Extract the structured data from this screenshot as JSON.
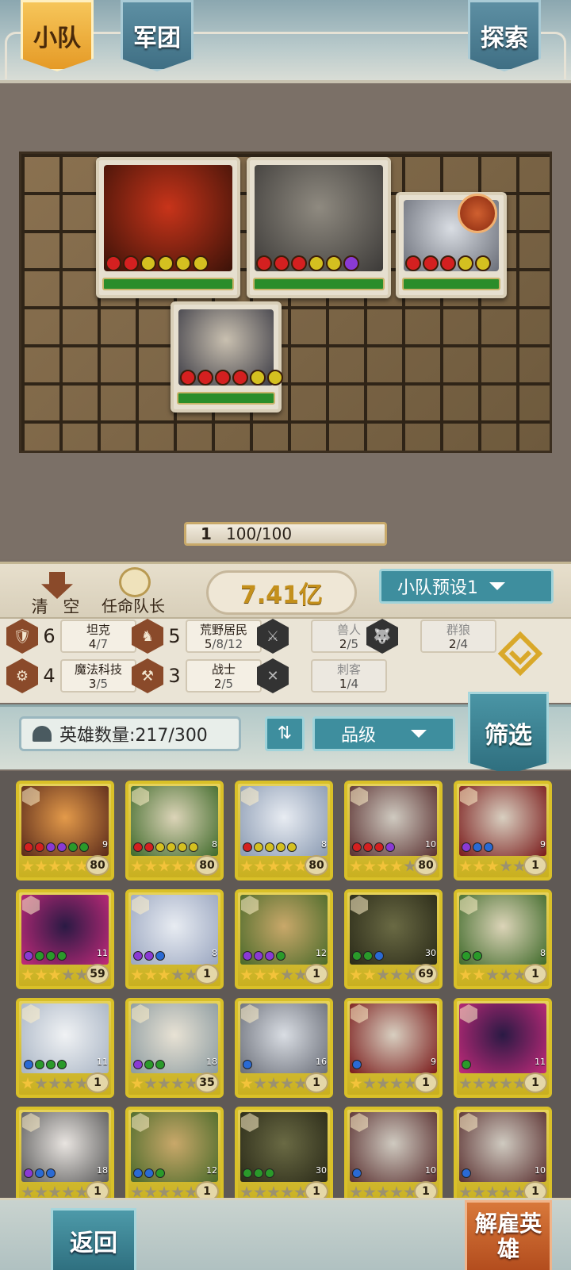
{
  "tabs": {
    "squad": "小队",
    "legion": "军团",
    "explore": "探索"
  },
  "board": {
    "level": "1",
    "progress": "100/100",
    "cards": [
      {
        "name": "fire-beast",
        "dots": [
          "#d42020",
          "#d42020",
          "#d4c020",
          "#d4c020",
          "#d4c020",
          "#d4c020"
        ],
        "colors": [
          "#c8341a",
          "#3a1208"
        ]
      },
      {
        "name": "stone-golem",
        "dots": [
          "#d42020",
          "#d42020",
          "#d42020",
          "#d4c020",
          "#d4c020",
          "#8a3ad4"
        ],
        "colors": [
          "#8f8a80",
          "#3c3a38"
        ]
      },
      {
        "name": "white-wolf",
        "dots": [
          "#d42020",
          "#d42020",
          "#d42020",
          "#d4c020",
          "#d4c020"
        ],
        "colors": [
          "#d9dde3",
          "#6a6e78"
        ]
      },
      {
        "name": "dark-wolf",
        "dots": [
          "#d42020",
          "#d42020",
          "#d42020",
          "#d42020",
          "#d4c020",
          "#d4c020"
        ],
        "colors": [
          "#c9c0b0",
          "#3a3a44"
        ]
      }
    ]
  },
  "captain": {
    "clear": "清 空",
    "appoint": "任命队长",
    "power": "7.41亿",
    "preset": "小队预设1"
  },
  "synergies": [
    {
      "count": "6",
      "name": "坦克",
      "cur": "4",
      "total": "/7",
      "icon": "🛡",
      "active": true
    },
    {
      "count": "5",
      "name": "荒野居民",
      "cur": "5",
      "total": "/8/12",
      "icon": "♞",
      "active": true
    },
    {
      "count": "",
      "name": "兽人",
      "cur": "2",
      "total": "/5",
      "icon": "⚔",
      "active": false
    },
    {
      "count": "",
      "name": "群狼",
      "cur": "2",
      "total": "/4",
      "icon": "🐺",
      "active": false
    },
    {
      "count": "4",
      "name": "魔法科技",
      "cur": "3",
      "total": "/5",
      "icon": "⚙",
      "active": true
    },
    {
      "count": "3",
      "name": "战士",
      "cur": "2",
      "total": "/5",
      "icon": "⚒",
      "active": true
    },
    {
      "count": "",
      "name": "刺客",
      "cur": "1",
      "total": "/4",
      "icon": "✕",
      "active": false
    }
  ],
  "toolbar": {
    "hero_count": "英雄数量:217/300",
    "sort": "⇅",
    "grade": "品级",
    "filter": "筛选"
  },
  "heroes": [
    {
      "stars": 5,
      "level": "80",
      "cost": "9",
      "dots": [
        "#d42020",
        "#d42020",
        "#8a3ad4",
        "#8a3ad4",
        "#2a9a2a",
        "#2a9a2a"
      ],
      "c1": "#e39a4a",
      "c2": "#5a2a1a"
    },
    {
      "stars": 5,
      "level": "80",
      "cost": "8",
      "dots": [
        "#d42020",
        "#d42020",
        "#d4c020",
        "#d4c020",
        "#d4c020",
        "#d4c020"
      ],
      "c1": "#dcd4b8",
      "c2": "#3f6a2a"
    },
    {
      "stars": 5,
      "level": "80",
      "cost": "8",
      "dots": [
        "#d42020",
        "#d4c020",
        "#d4c020",
        "#d4c020",
        "#d4c020"
      ],
      "c1": "#e8ecf2",
      "c2": "#8a9ab2"
    },
    {
      "stars": 4,
      "level": "80",
      "cost": "10",
      "dots": [
        "#d42020",
        "#d42020",
        "#d42020",
        "#8a3ad4"
      ],
      "c1": "#cfcac0",
      "c2": "#5a3030"
    },
    {
      "stars": 3,
      "level": "1",
      "cost": "9",
      "dots": [
        "#8a3ad4",
        "#2a6ad4",
        "#2a6ad4"
      ],
      "c1": "#d8cfc0",
      "c2": "#7a1a1a"
    },
    {
      "stars": 3,
      "level": "59",
      "cost": "11",
      "dots": [
        "#8a3ad4",
        "#2a9a2a",
        "#2a9a2a",
        "#2a9a2a"
      ],
      "c1": "#2a1a44",
      "c2": "#c22a7a"
    },
    {
      "stars": 3,
      "level": "1",
      "cost": "8",
      "dots": [
        "#8a3ad4",
        "#8a3ad4",
        "#2a6ad4"
      ],
      "c1": "#e8ecf2",
      "c2": "#9aa6c0"
    },
    {
      "stars": 3,
      "level": "1",
      "cost": "12",
      "dots": [
        "#8a3ad4",
        "#8a3ad4",
        "#8a3ad4",
        "#2a9a2a"
      ],
      "c1": "#c9a86a",
      "c2": "#4a6a2a"
    },
    {
      "stars": 2,
      "level": "69",
      "cost": "30",
      "dots": [
        "#2a9a2a",
        "#2a9a2a",
        "#2a6ad4"
      ],
      "c1": "#6a6a44",
      "c2": "#2a2a18"
    },
    {
      "stars": 2,
      "level": "1",
      "cost": "8",
      "dots": [
        "#2a9a2a",
        "#2a9a2a"
      ],
      "c1": "#dcd4b8",
      "c2": "#3f6a2a"
    },
    {
      "stars": 1,
      "level": "1",
      "cost": "11",
      "dots": [
        "#2a6ad4",
        "#2a9a2a",
        "#2a9a2a",
        "#2a9a2a"
      ],
      "c1": "#f0f2f4",
      "c2": "#a8b4c4"
    },
    {
      "stars": 1,
      "level": "35",
      "cost": "18",
      "dots": [
        "#8a3ad4",
        "#2a9a2a",
        "#2a9a2a"
      ],
      "c1": "#e8e2d4",
      "c2": "#8a9aa0"
    },
    {
      "stars": 1,
      "level": "1",
      "cost": "16",
      "dots": [
        "#2a6ad4"
      ],
      "c1": "#d9dde3",
      "c2": "#6a6e78"
    },
    {
      "stars": 1,
      "level": "1",
      "cost": "9",
      "dots": [
        "#2a6ad4"
      ],
      "c1": "#d8cfc0",
      "c2": "#7a1a1a"
    },
    {
      "stars": 0,
      "level": "1",
      "cost": "11",
      "dots": [
        "#2a9a2a"
      ],
      "c1": "#2a1a44",
      "c2": "#c22a7a"
    },
    {
      "stars": 0,
      "level": "1",
      "cost": "18",
      "dots": [
        "#8a3ad4",
        "#2a6ad4",
        "#2a6ad4"
      ],
      "c1": "#e8e4e0",
      "c2": "#5a5a5a"
    },
    {
      "stars": 0,
      "level": "1",
      "cost": "12",
      "dots": [
        "#2a6ad4",
        "#2a6ad4",
        "#2a9a2a"
      ],
      "c1": "#c9a86a",
      "c2": "#4a6a2a"
    },
    {
      "stars": 0,
      "level": "1",
      "cost": "30",
      "dots": [
        "#2a9a2a",
        "#2a9a2a",
        "#2a9a2a"
      ],
      "c1": "#6a6a44",
      "c2": "#2a2a18"
    },
    {
      "stars": 0,
      "level": "1",
      "cost": "10",
      "dots": [
        "#2a6ad4"
      ],
      "c1": "#cfcac0",
      "c2": "#5a3030"
    },
    {
      "stars": 0,
      "level": "1",
      "cost": "10",
      "dots": [
        "#2a6ad4"
      ],
      "c1": "#cfcac0",
      "c2": "#5a3030"
    }
  ],
  "footer": {
    "back": "返回",
    "dismiss": "解雇英雄"
  }
}
